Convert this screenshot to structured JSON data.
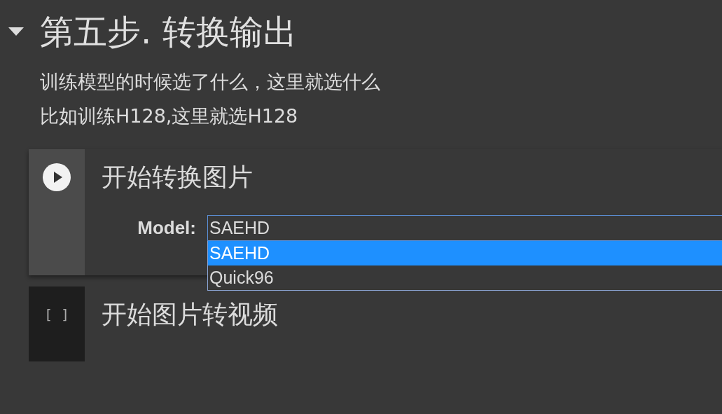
{
  "section": {
    "expanded": true,
    "title": "第五步. 转换输出",
    "description": [
      "训练模型的时候选了什么，这里就选什么",
      "比如训练H128,这里就选H128"
    ]
  },
  "cells": [
    {
      "kind": "form",
      "focused": true,
      "title": "开始转换图片",
      "field": {
        "label": "Model:",
        "value": "SAEHD",
        "open": true,
        "options": [
          {
            "label": "SAEHD",
            "selected": true
          },
          {
            "label": "Quick96",
            "selected": false
          }
        ]
      }
    },
    {
      "kind": "code",
      "focused": false,
      "marker": "[ ]",
      "title": "开始图片转视频"
    }
  ]
}
